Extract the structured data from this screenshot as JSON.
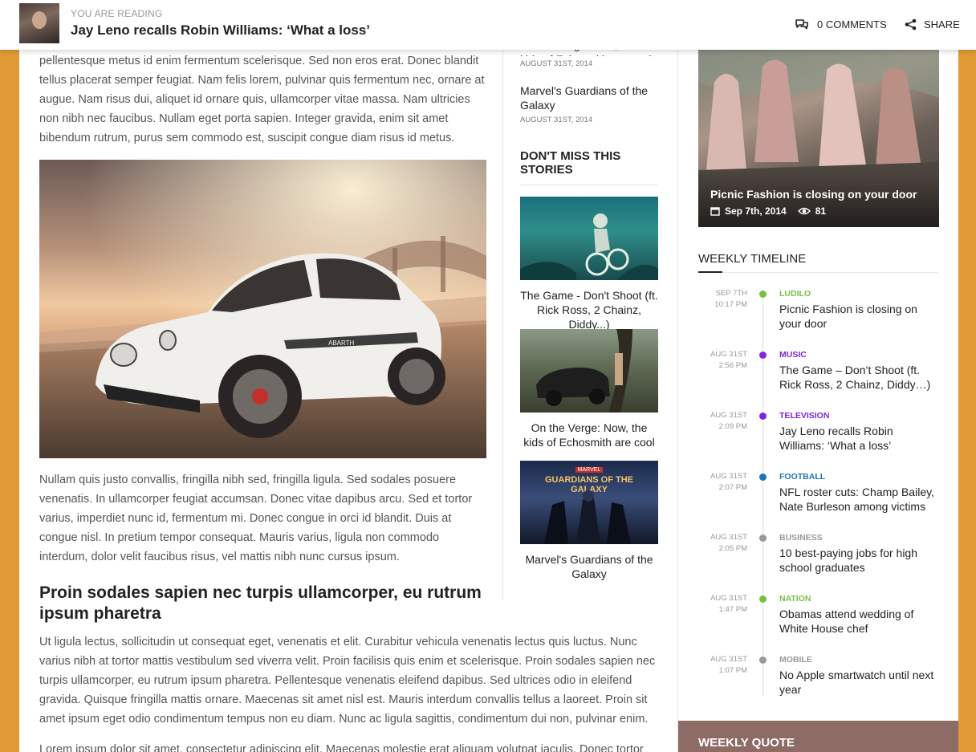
{
  "topbar": {
    "kicker": "YOU ARE READING",
    "title": "Jay Leno recalls Robin Williams: ‘What a loss’",
    "comments_label": "0 COMMENTS",
    "share_label": "SHARE"
  },
  "article": {
    "para1": "pellentesque metus id enim fermentum scelerisque. Sed non eros erat. Donec blandit tellus placerat semper feugiat. Nam felis lorem, pulvinar quis fermentum nec, ornare at augue. Nam risus dui, aliquet id ornare quis, ullamcorper vitae massa. Nam ultricies non nibh nec faucibus. Nullam eget porta sapien. Integer gravida, enim sit amet bibendum rutrum, purus sem commodo est, suscipit congue diam risus id metus.",
    "car_logo": "ABARTH",
    "para2": "Nullam quis justo convallis, fringilla nibh sed, fringilla ligula. Sed sodales posuere venenatis. In ullamcorper feugiat accumsan. Donec vitae dapibus arcu. Sed et tortor varius, imperdiet nunc id, fermentum mi. Donec congue in orci id blandit. Duis at congue nisl. In pretium tempor consequat. Mauris varius, ligula non commodo interdum, dolor velit faucibus risus, vel mattis nibh nunc cursus ipsum.",
    "subheading": "Proin sodales sapien nec turpis ullamcorper, eu rutrum ipsum pharetra",
    "para3": "Ut ligula lectus, sollicitudin ut consequat eget, venenatis et elit. Curabitur vehicula venenatis lectus quis luctus. Nunc varius nibh at tortor mattis vestibulum sed viverra velit. Proin facilisis quis enim et scelerisque. Proin sodales sapien nec turpis ullamcorper, eu rutrum ipsum pharetra. Pellentesque venenatis eleifend dapibus. Sed ultrices odio in eleifend gravida. Quisque fringilla mattis ornare. Maecenas sit amet nisl est. Mauris interdum convallis tellus a laoreet. Proin sit amet ipsum eget odio condimentum tempus non eu diam. Nunc ac ligula sagittis, condimentum dui non, pulvinar enim.",
    "para4": "Lorem ipsum dolor sit amet, consectetur adipiscing elit. Maecenas molestie erat aliquam volutpat iaculis. Donec tortor"
  },
  "middle": {
    "related": [
      {
        "title": "On the Verge: Now, the kids of Echosmith are cool",
        "date": "AUGUST 31ST, 2014"
      },
      {
        "title": "Marvel's Guardians of the Galaxy",
        "date": "AUGUST 31ST, 2014"
      }
    ],
    "dont_miss_title": "DON'T MISS THIS STORIES",
    "stories": [
      {
        "caption": "The Game - Don't Shoot (ft. Rick Ross, 2 Chainz, Diddy...)"
      },
      {
        "caption": "On the Verge: Now, the kids of Echosmith are cool"
      },
      {
        "caption": "Marvel's Guardians of the Galaxy",
        "poster_text_1": "MARVEL",
        "poster_text_2": "GUARDIANS OF THE GALAXY"
      }
    ]
  },
  "sidebar": {
    "featured": {
      "title": "Picnic Fashion is closing on your door",
      "date": "Sep 7th, 2014",
      "views": "81"
    },
    "weekly_timeline_title": "WEEKLY TIMELINE",
    "timeline": [
      {
        "date": "SEP 7TH",
        "time": "10:17 PM",
        "category": "LUDILO",
        "color": "#7ac143",
        "headline": "Picnic Fashion is closing on your door"
      },
      {
        "date": "AUG 31ST",
        "time": "2:56 PM",
        "category": "MUSIC",
        "color": "#8224e3",
        "headline": "The Game – Don’t Shoot (ft. Rick Ross, 2 Chainz, Diddy…)"
      },
      {
        "date": "AUG 31ST",
        "time": "2:09 PM",
        "category": "TELEVISION",
        "color": "#8224e3",
        "headline": "Jay Leno recalls Robin Williams: ‘What a loss’"
      },
      {
        "date": "AUG 31ST",
        "time": "2:07 PM",
        "category": "FOOTBALL",
        "color": "#1e73be",
        "headline": "NFL roster cuts: Champ Bailey, Nate Burleson among victims"
      },
      {
        "date": "AUG 31ST",
        "time": "2:05 PM",
        "category": "BUSINESS",
        "color": "#999999",
        "headline": "10 best-paying jobs for high school graduates"
      },
      {
        "date": "AUG 31ST",
        "time": "1:47 PM",
        "category": "NATION",
        "color": "#7ac143",
        "headline": "Obamas attend wedding of White House chef"
      },
      {
        "date": "AUG 31ST",
        "time": "1:07 PM",
        "category": "MOBILE",
        "color": "#999999",
        "headline": "No Apple smartwatch until next year"
      }
    ],
    "weekly_quote_title": "WEEKLY QUOTE"
  },
  "colors": {
    "accent_orange": "#e19a35",
    "quote_bg": "#8f6b66"
  }
}
